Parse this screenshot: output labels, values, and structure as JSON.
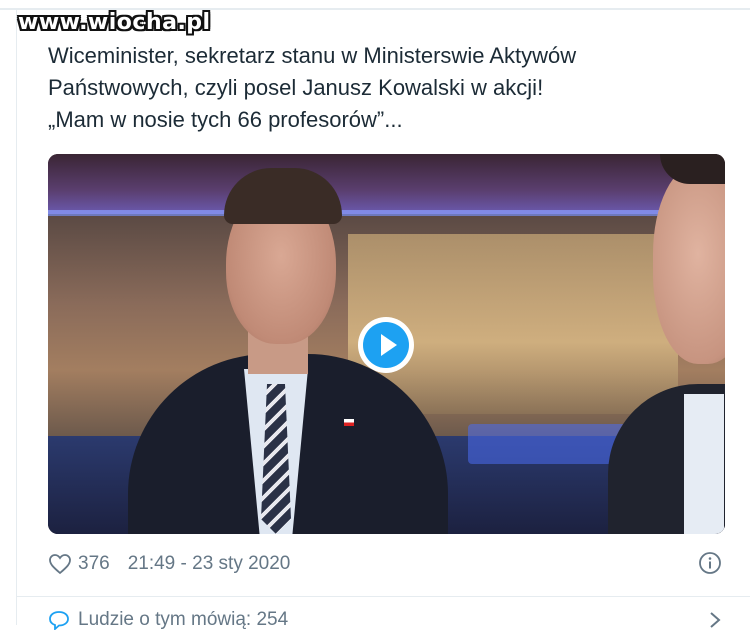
{
  "watermark": "www.wiocha.pl",
  "tweet": {
    "text_lines": [
      "Wiceminister, sekretarz stanu w Ministerswie Aktywów",
      "Państwowych, czyli posel Janusz Kowalski w akcji!",
      "„Mam w nosie tych 66 profesorów”..."
    ],
    "like_count": "376",
    "timestamp": "21:49 - 23 sty 2020"
  },
  "video": {
    "play_icon": "play-icon",
    "accent_color": "#1da1f2"
  },
  "related": {
    "label": "Ludzie o tym mówią: 254"
  },
  "icons": {
    "like": "heart-icon",
    "info": "info-icon",
    "comment": "comment-icon",
    "chevron": "chevron-right-icon"
  }
}
